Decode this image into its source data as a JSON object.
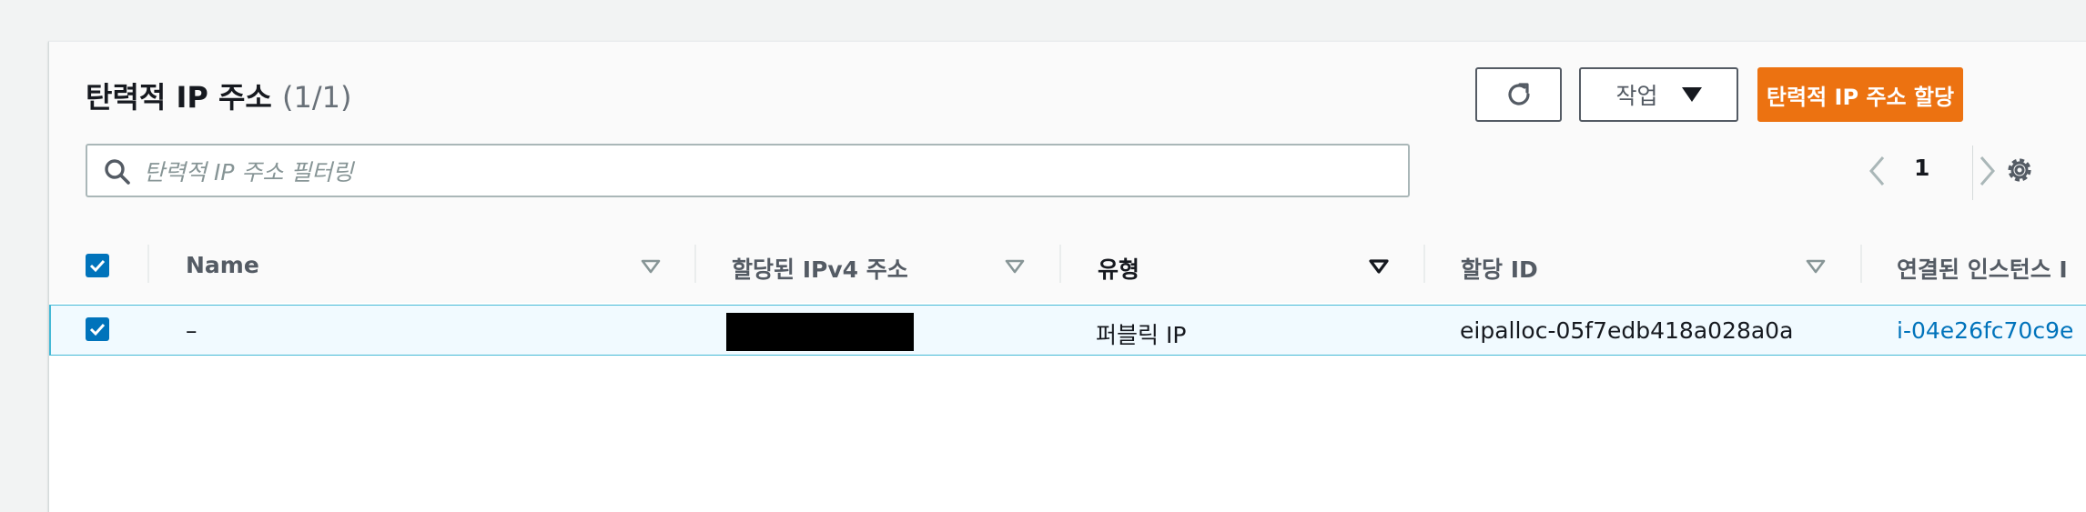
{
  "header": {
    "title": "탄력적 IP 주소",
    "count": "(1/1)",
    "actions_label": "작업",
    "allocate_label": "탄력적 IP 주소 할당",
    "search_placeholder": "탄력적 IP 주소 필터링",
    "page_number": "1"
  },
  "table": {
    "columns": [
      {
        "label": "Name",
        "sortable": true
      },
      {
        "label": "할당된 IPv4 주소",
        "sortable": true
      },
      {
        "label": "유형",
        "sortable": true,
        "active_sort": true
      },
      {
        "label": "할당 ID",
        "sortable": true
      },
      {
        "label": "연결된 인스턴스 I"
      }
    ],
    "rows": [
      {
        "selected": true,
        "name": "–",
        "ipv4": "",
        "ipv4_redacted": true,
        "type": "퍼블릭 IP",
        "allocation_id": "eipalloc-05f7edb418a028a0a",
        "instance_id": "i-04e26fc70c9e"
      }
    ]
  },
  "colors": {
    "accent": "#ec7211",
    "selection": "#0073bb",
    "row_highlight": "#f1faff",
    "row_border": "#44b9d6"
  },
  "icons": {
    "refresh": "refresh-icon",
    "caret": "caret-down-icon",
    "search": "search-icon",
    "prev": "chevron-left-icon",
    "next": "chevron-right-icon",
    "settings": "gear-icon",
    "sort": "sort-triangle-icon",
    "check": "check-icon"
  }
}
